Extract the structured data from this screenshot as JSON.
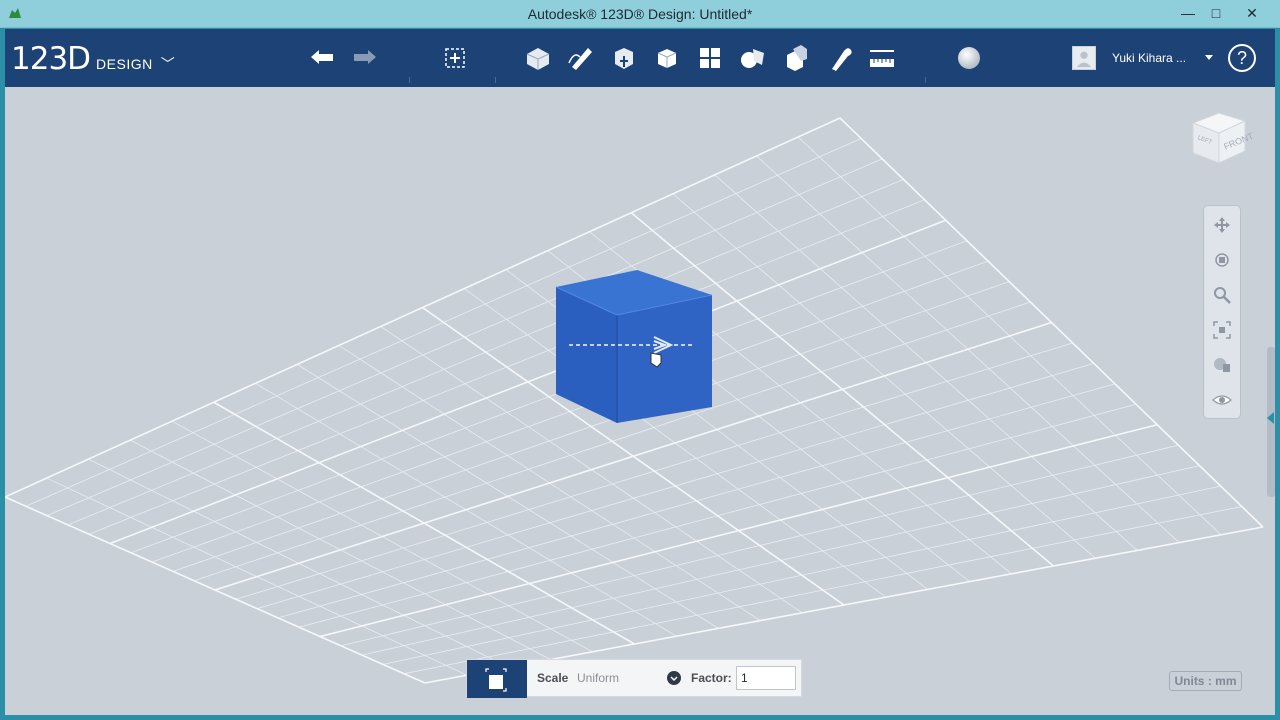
{
  "window": {
    "title": "Autodesk® 123D® Design: Untitled*",
    "minimize_label": "—",
    "maximize_label": "□",
    "close_label": "✕"
  },
  "toolbar": {
    "logo_number": "123D",
    "logo_word": "DESIGN",
    "logo_chevron": "﹀",
    "icons": [
      "undo-icon",
      "redo-icon",
      "add-new-icon",
      "primitives-icon",
      "sketch-icon",
      "construct-icon",
      "modify-icon",
      "pattern-icon",
      "grouping-icon",
      "combine-icon",
      "snap-icon",
      "measure-icon",
      "material-icon"
    ]
  },
  "user": {
    "name": "Yuki Kihara ..."
  },
  "help": {
    "label": "?"
  },
  "viewcube": {
    "face_front": "FRONT",
    "face_left": "LEFT"
  },
  "scale_panel": {
    "scale_label": "Scale",
    "scale_value": "Uniform",
    "factor_label": "Factor:",
    "factor_value": "1"
  },
  "units": {
    "label": "Units : mm"
  },
  "colors": {
    "toolbar_bg": "#1d4275",
    "cube_front": "#2f63c4",
    "cube_top": "#3a74d3",
    "viewport_bg": "#c9d0d8",
    "frame": "#2b8fa8"
  }
}
